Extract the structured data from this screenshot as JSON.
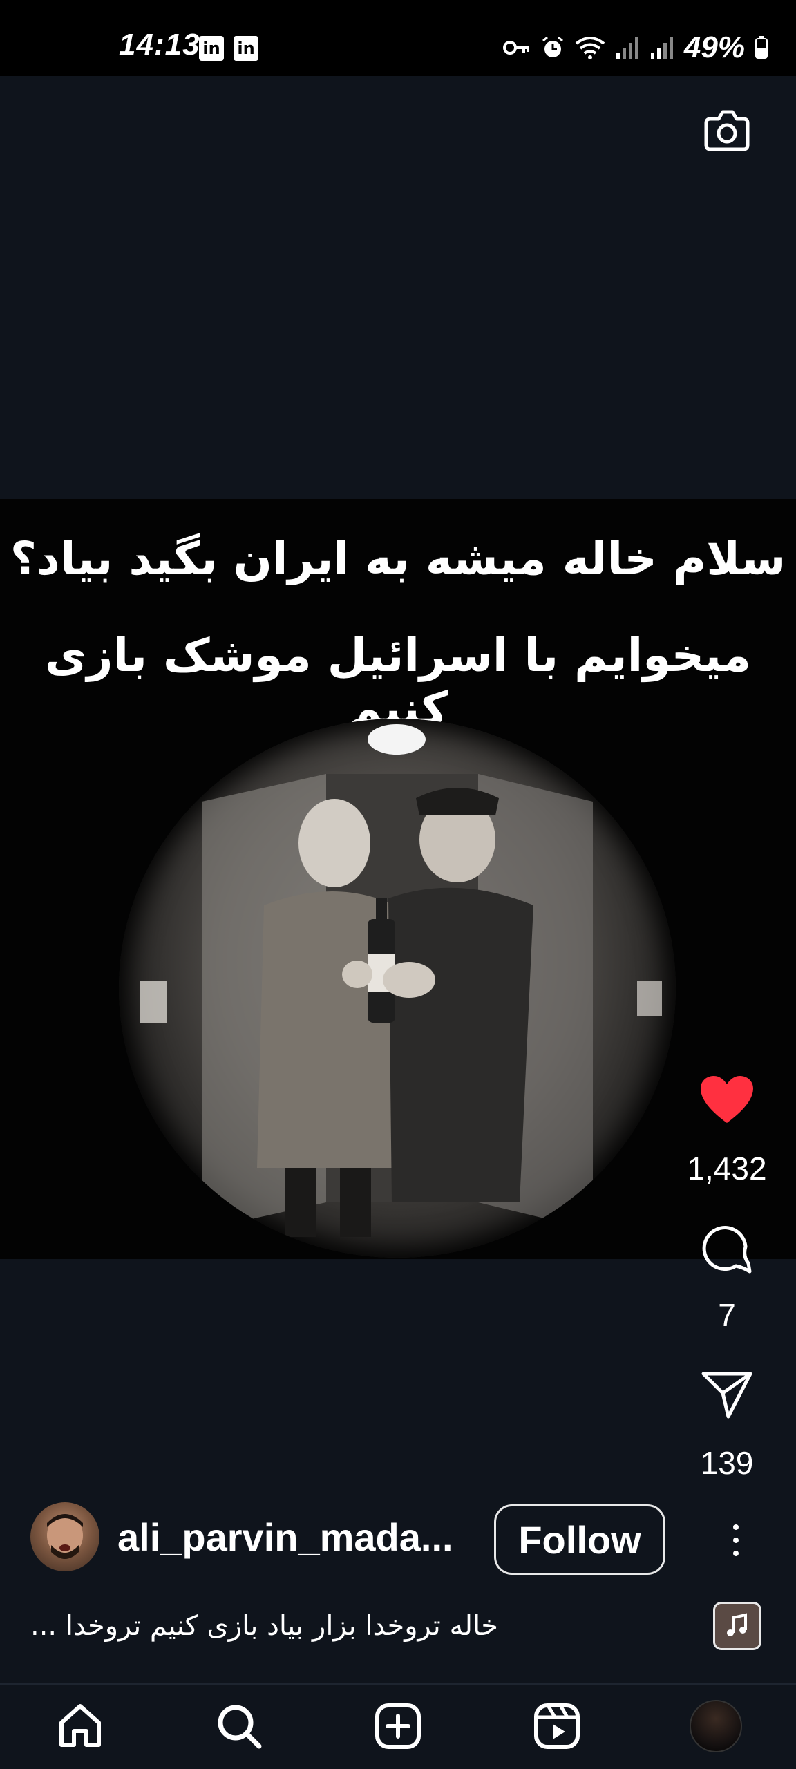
{
  "status_bar": {
    "time": "14:13",
    "notification_icons": [
      "in",
      "in"
    ],
    "battery": "49%"
  },
  "post": {
    "overlay_caption": {
      "line1": "سلام خاله میشه به ایران بگید بیاد؟",
      "line2": "میخوایم با اسرائیل موشک بازی کنیم"
    },
    "likes": "1,432",
    "comments": "7",
    "shares": "139",
    "author": {
      "username": "ali_parvin_mada...",
      "follow_label": "Follow"
    },
    "caption": "خاله تروخدا بزار بیاد بازی کنیم تروخدا ..."
  },
  "colors": {
    "background": "#0f141c",
    "like_red": "#ff3040",
    "text": "#ffffff"
  },
  "icons": {
    "camera": "camera-icon",
    "like": "heart-icon",
    "comment": "comment-icon",
    "share": "send-icon",
    "more": "more-vertical-icon",
    "music": "music-note-icon",
    "nav": [
      "home-icon",
      "search-icon",
      "create-icon",
      "reels-icon",
      "profile-avatar"
    ]
  }
}
